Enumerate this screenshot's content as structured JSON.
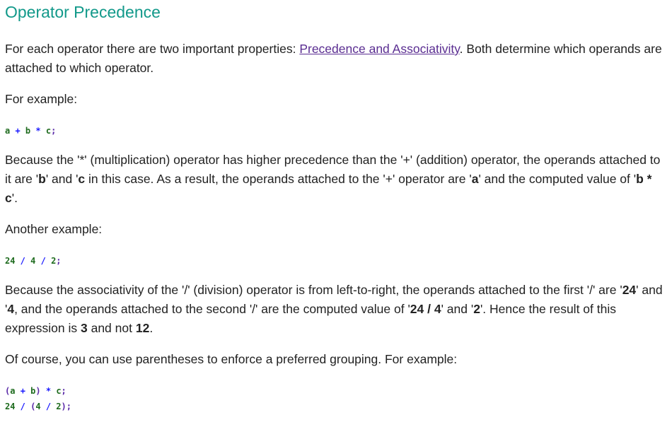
{
  "title": "Operator Precedence",
  "blocks": [
    {
      "type": "p",
      "segs": [
        {
          "t": "For each operator there are two important properties: "
        },
        {
          "t": "Precedence and Associativity",
          "link": true
        },
        {
          "t": ". Both determine which operands are attached to which operator."
        }
      ]
    },
    {
      "type": "p",
      "segs": [
        {
          "t": "For example:"
        }
      ]
    },
    {
      "type": "code",
      "lines": [
        [
          [
            "a",
            "id"
          ],
          [
            " + ",
            "op"
          ],
          [
            "b",
            "id"
          ],
          [
            " * ",
            "op"
          ],
          [
            "c",
            "id"
          ],
          [
            ";",
            "pn"
          ]
        ]
      ]
    },
    {
      "type": "p",
      "segs": [
        {
          "t": "Because the '*' (multiplication) operator has higher precedence than the '+' (addition) operator, the operands attached to it are '"
        },
        {
          "t": "b",
          "b": true
        },
        {
          "t": "' and '"
        },
        {
          "t": "c",
          "b": true
        },
        {
          "t": " in this case. As a result, the operands attached to the '+' operator are '"
        },
        {
          "t": "a",
          "b": true
        },
        {
          "t": "' and the computed value of '"
        },
        {
          "t": "b * c",
          "b": true
        },
        {
          "t": "'."
        }
      ]
    },
    {
      "type": "p",
      "segs": [
        {
          "t": "Another example:"
        }
      ]
    },
    {
      "type": "code",
      "lines": [
        [
          [
            "24",
            "id"
          ],
          [
            " / ",
            "op"
          ],
          [
            "4",
            "id"
          ],
          [
            " / ",
            "op"
          ],
          [
            "2",
            "id"
          ],
          [
            ";",
            "pn"
          ]
        ]
      ]
    },
    {
      "type": "p",
      "segs": [
        {
          "t": "Because the associativity of the '/' (division) operator is from left-to-right, the operands attached to the first '/' are '"
        },
        {
          "t": "24",
          "b": true
        },
        {
          "t": "' and '"
        },
        {
          "t": "4",
          "b": true
        },
        {
          "t": ", and the operands attached to the second '/' are the computed value of '"
        },
        {
          "t": "24 / 4",
          "b": true
        },
        {
          "t": "' and '"
        },
        {
          "t": "2",
          "b": true
        },
        {
          "t": "'. Hence the result of this expression is "
        },
        {
          "t": "3",
          "b": true
        },
        {
          "t": " and not "
        },
        {
          "t": "12",
          "b": true
        },
        {
          "t": "."
        }
      ]
    },
    {
      "type": "p",
      "segs": [
        {
          "t": "Of course, you can use parentheses to enforce a preferred grouping. For example:"
        }
      ]
    },
    {
      "type": "code",
      "lines": [
        [
          [
            "(",
            "pn"
          ],
          [
            "a",
            "id"
          ],
          [
            " + ",
            "op"
          ],
          [
            "b",
            "id"
          ],
          [
            ")",
            "pn"
          ],
          [
            " * ",
            "op"
          ],
          [
            "c",
            "id"
          ],
          [
            ";",
            "pn"
          ]
        ],
        [
          [
            "24",
            "id"
          ],
          [
            " / ",
            "op"
          ],
          [
            "(",
            "pn"
          ],
          [
            "4",
            "id"
          ],
          [
            " / ",
            "op"
          ],
          [
            "2",
            "id"
          ],
          [
            ")",
            "pn"
          ],
          [
            ";",
            "pn"
          ]
        ]
      ]
    }
  ]
}
